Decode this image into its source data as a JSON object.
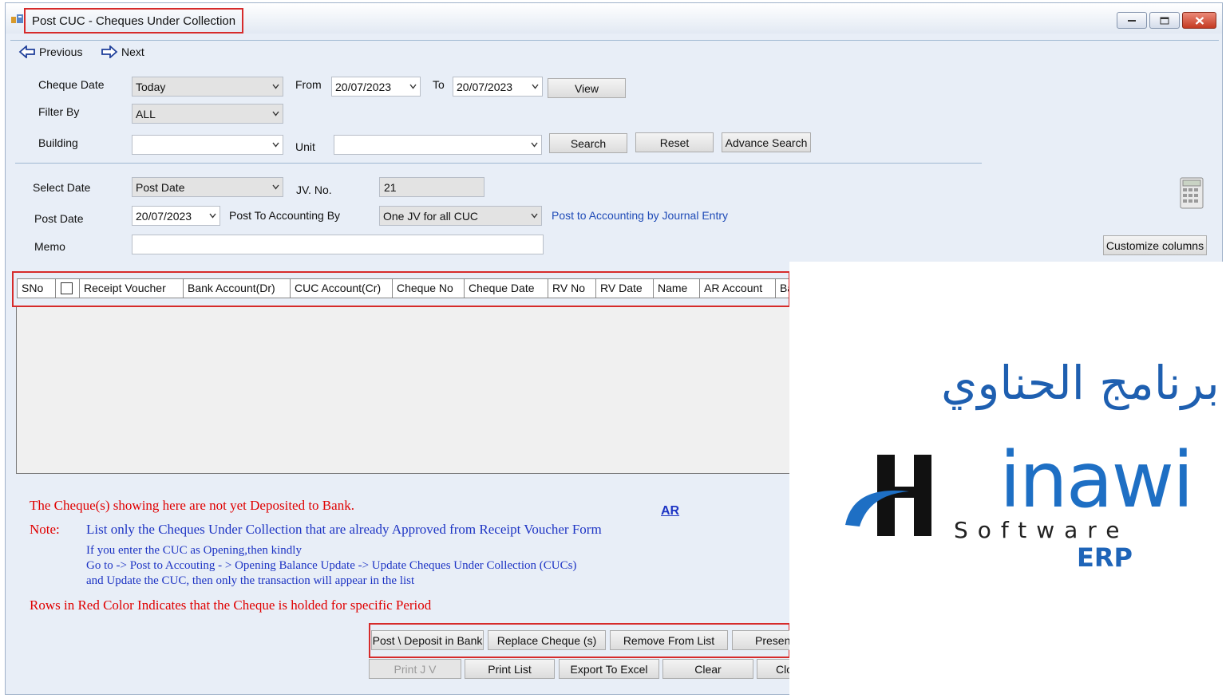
{
  "window": {
    "title": "Post CUC - Cheques Under Collection"
  },
  "nav": {
    "previous": "Previous",
    "next": "Next"
  },
  "filters": {
    "cheque_date_label": "Cheque Date",
    "cheque_date_value": "Today",
    "from_label": "From",
    "from_value": "20/07/2023",
    "to_label": "To",
    "to_value": "20/07/2023",
    "view_button": "View",
    "filter_by_label": "Filter By",
    "filter_by_value": "ALL",
    "building_label": "Building",
    "building_value": "",
    "unit_label": "Unit",
    "unit_value": "",
    "search_button": "Search",
    "reset_button": "Reset",
    "advance_search_button": "Advance Search"
  },
  "posting": {
    "select_date_label": "Select Date",
    "select_date_value": "Post Date",
    "jv_no_label": "JV. No.",
    "jv_no_value": "21",
    "post_date_label": "Post Date",
    "post_date_value": "20/07/2023",
    "post_by_label": "Post To Accounting By",
    "post_by_value": "One JV for all CUC",
    "post_link": "Post to Accounting by Journal Entry",
    "memo_label": "Memo",
    "memo_value": "",
    "customize_columns_button": "Customize columns",
    "calculator_icon": "calculator-icon"
  },
  "grid": {
    "columns": [
      "SNo",
      "",
      "Receipt Voucher",
      "Bank Account(Dr)",
      "CUC Account(Cr)",
      "Cheque No",
      "Cheque Date",
      "RV No",
      "RV Date",
      "Name",
      "AR Account",
      "Ba"
    ]
  },
  "notes": {
    "line1": "The Cheque(s) showing here are not yet Deposited to Bank.",
    "note_label": "Note:",
    "line2": "List only the Cheques Under Collection that are already Approved from Receipt Voucher Form",
    "line3": "If you enter the CUC as Opening,then kindly",
    "line4": "Go to -> Post to Accouting - > Opening Balance Update -> Update Cheques Under Collection (CUCs)",
    "line5": "and Update the CUC, then only the transaction will appear in the list",
    "line6": "Rows in Red Color Indicates that the Cheque is holded for specific Period",
    "ar_link": "AR"
  },
  "actions": {
    "post_deposit": "Post \\ Deposit in Bank",
    "replace_cheque": "Replace Cheque (s)",
    "remove_from_list": "Remove From List",
    "present": "Presen",
    "print_jv": "Print J V",
    "print_list": "Print List",
    "export_excel": "Export To Excel",
    "clear": "Clear",
    "close": "Clo"
  },
  "logo": {
    "arabic": "برنامج الحناوي",
    "word": "Hinawi",
    "software": "Software",
    "erp": "ERP"
  },
  "colors": {
    "highlight_red": "#d62b2b",
    "link_blue": "#1f4bb7",
    "note_red": "#e00000",
    "note_blue": "#1d34c4",
    "brand_blue": "#1e6fc4"
  }
}
